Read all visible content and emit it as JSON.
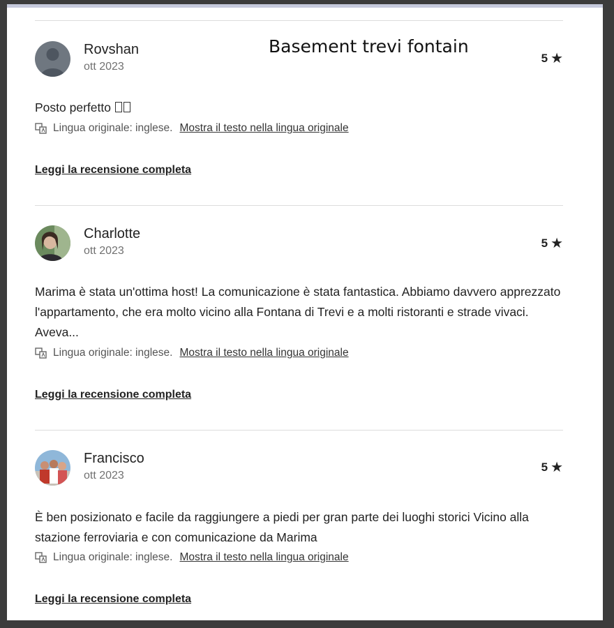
{
  "overlay_title": "Basement trevi fontain",
  "common": {
    "lang_label": "Lingua originale: inglese.",
    "lang_link": "Mostra il testo nella lingua originale",
    "read_full": "Leggi la recensione completa",
    "star": "★"
  },
  "reviews": [
    {
      "name": "Rovshan",
      "date": "ott 2023",
      "rating": "5",
      "text": "Posto perfetto ",
      "avatar": "default-silhouette-avatar"
    },
    {
      "name": "Charlotte",
      "date": "ott 2023",
      "rating": "5",
      "text": "Marima è stata un'ottima host! La comunicazione è stata fantastica. Abbiamo davvero apprezzato l'appartamento, che era molto vicino alla Fontana di Trevi e a molti ristoranti e strade vivaci. Aveva...",
      "avatar": "photo-avatar-woman"
    },
    {
      "name": "Francisco",
      "date": "ott 2023",
      "rating": "5",
      "text": "È ben posizionato e facile da raggiungere a piedi per gran parte dei luoghi storici Vicino alla stazione ferroviaria e con comunicazione da Marima",
      "avatar": "photo-avatar-group"
    }
  ],
  "colors": {
    "text": "#222222",
    "muted": "#717171",
    "divider": "#dcdcdc",
    "frame": "#3c3c3c"
  }
}
